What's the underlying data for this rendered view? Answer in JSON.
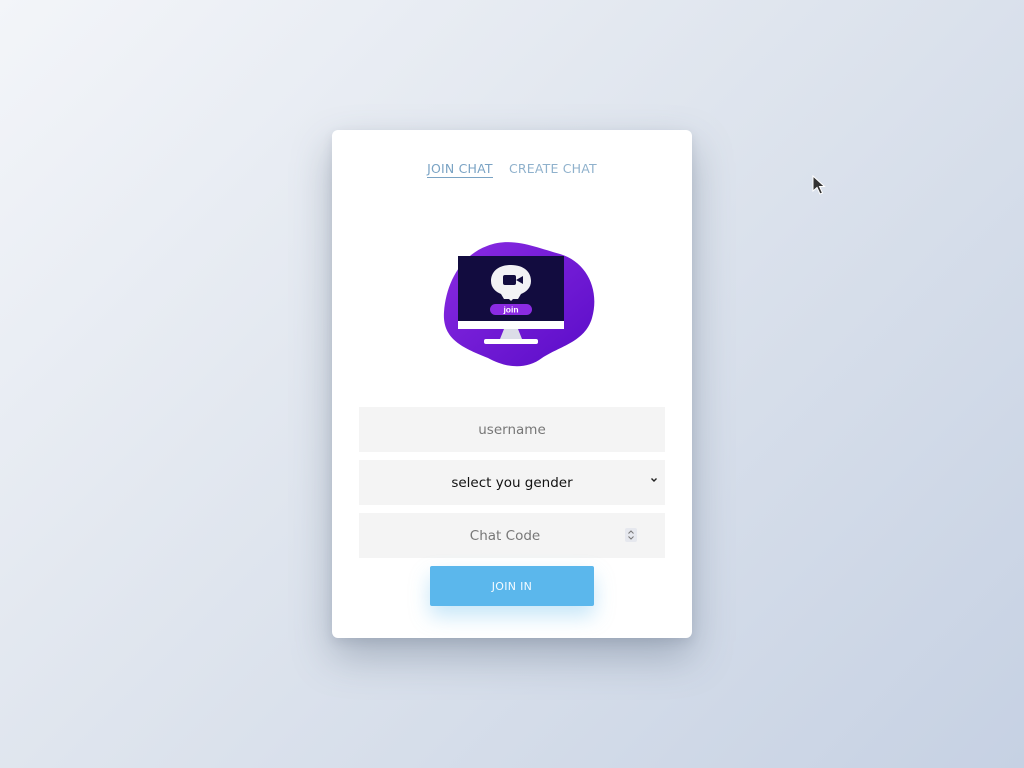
{
  "tabs": {
    "join": "JOIN CHAT",
    "create": "CREATE CHAT"
  },
  "illustration": {
    "button_text": "join",
    "icon": "video-camera-icon"
  },
  "form": {
    "username_placeholder": "username",
    "gender_selected": "select you gender",
    "chat_code_placeholder": "Chat Code",
    "submit_label": "JOIN IN"
  },
  "colors": {
    "accent": "#5bb7ec",
    "tab_link": "#8fb1cc",
    "blob_purple": "#6b12d4",
    "monitor_screen": "#120c3f"
  },
  "icons": {
    "gender_chevron": "chevron-down-icon",
    "code_spinner": "spinner-icon",
    "cursor": "mouse-pointer-icon"
  }
}
